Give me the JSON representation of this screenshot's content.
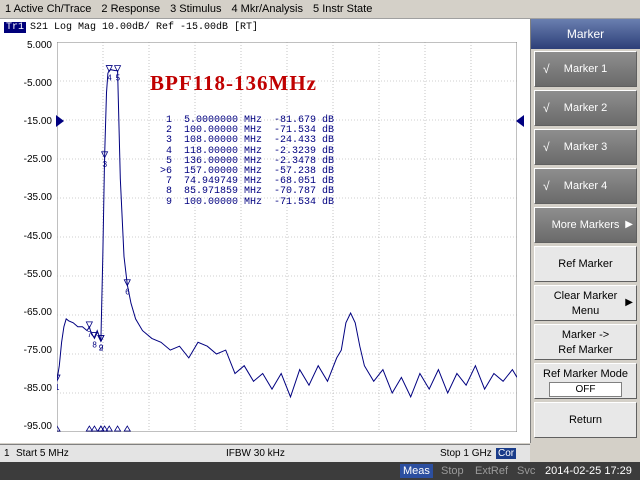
{
  "menu": [
    "1 Active Ch/Trace",
    "2 Response",
    "3 Stimulus",
    "4 Mkr/Analysis",
    "5 Instr State"
  ],
  "trace_header": {
    "badge": "Tr1",
    "text": "S21 Log Mag 10.00dB/ Ref -15.00dB [RT]"
  },
  "title": "BPF118-136MHz",
  "y_axis_labels": [
    "5.000",
    "-5.000",
    "-15.00",
    "-25.00",
    "-35.00",
    "-45.00",
    "-55.00",
    "-65.00",
    "-75.00",
    "-85.00",
    "-95.00"
  ],
  "marker_table": [
    {
      "num": "1",
      "freq": "5.0000000 MHz",
      "val": "-81.679 dB"
    },
    {
      "num": "2",
      "freq": "100.00000 MHz",
      "val": "-71.534 dB"
    },
    {
      "num": "3",
      "freq": "108.00000 MHz",
      "val": "-24.433 dB"
    },
    {
      "num": "4",
      "freq": "118.00000 MHz",
      "val": "-2.3239 dB"
    },
    {
      "num": "5",
      "freq": "136.00000 MHz",
      "val": "-2.3478 dB"
    },
    {
      "num": ">6",
      "freq": "157.00000 MHz",
      "val": "-57.238 dB"
    },
    {
      "num": "7",
      "freq": "74.949749 MHz",
      "val": "-68.051 dB"
    },
    {
      "num": "8",
      "freq": "85.971859 MHz",
      "val": "-70.787 dB"
    },
    {
      "num": "9",
      "freq": "100.00000 MHz",
      "val": "-71.534 dB"
    }
  ],
  "bottom": {
    "channel": "1",
    "start": "Start 5 MHz",
    "ifbw": "IFBW 30 kHz",
    "stop": "Stop 1 GHz",
    "cor": "Cor"
  },
  "softkeys": {
    "header": "Marker",
    "check": "√",
    "marker1": "Marker 1",
    "marker2": "Marker 2",
    "marker3": "Marker 3",
    "marker4": "Marker 4",
    "more_markers": "More Markers",
    "ref_marker": "Ref Marker",
    "clear_marker_1": "Clear Marker",
    "clear_marker_2": "Menu",
    "marker_to_ref_1": "Marker ->",
    "marker_to_ref_2": "Ref Marker",
    "ref_marker_mode": "Ref Marker Mode",
    "ref_marker_mode_value": "OFF",
    "return": "Return"
  },
  "status": {
    "meas": "Meas",
    "stop": "Stop",
    "extref": "ExtRef",
    "svc": "Svc",
    "datetime": "2014-02-25 17:29"
  },
  "colors": {
    "trace": "#000080",
    "title": "#c00000",
    "softkey_header": "#2d3f78"
  },
  "chart_data": {
    "type": "line",
    "x_unit": "MHz",
    "xlim": [
      5,
      1000
    ],
    "ylim": [
      -95,
      5
    ],
    "grid": true,
    "series": [
      {
        "x": [
          5,
          10,
          15,
          20,
          25,
          30,
          40,
          50,
          60,
          70,
          74.95,
          80,
          85.97,
          92,
          100,
          104,
          108,
          112,
          115,
          118,
          122,
          126,
          130,
          136,
          142,
          150,
          157,
          165,
          175,
          190,
          210,
          230,
          250,
          270,
          290,
          310,
          330,
          350,
          370,
          390,
          410,
          430,
          450,
          470,
          490,
          510,
          530,
          550,
          570,
          590,
          610,
          620,
          630,
          640,
          650,
          660,
          670,
          690,
          710,
          730,
          750,
          770,
          790,
          810,
          830,
          850,
          870,
          890,
          910,
          930,
          950,
          970,
          990,
          1000
        ],
        "y": [
          -81.7,
          -78,
          -72,
          -68,
          -66,
          -66.5,
          -67,
          -68,
          -68,
          -69,
          -68.05,
          -70,
          -70.79,
          -69,
          -71.53,
          -50,
          -24.43,
          -8,
          -3,
          -2.32,
          -2.1,
          -2.2,
          -2.3,
          -2.35,
          -30,
          -50,
          -57.24,
          -62,
          -66,
          -69,
          -71,
          -72,
          -74,
          -73,
          -76,
          -72,
          -73,
          -75,
          -74,
          -80,
          -78,
          -82,
          -80,
          -84,
          -80,
          -86,
          -79,
          -83,
          -78,
          -82,
          -76,
          -74,
          -67,
          -64.5,
          -67,
          -73,
          -78,
          -82,
          -79,
          -85,
          -81,
          -86,
          -80,
          -84,
          -79,
          -85,
          -80,
          -83,
          -78,
          -84,
          -80,
          -82,
          -79,
          -81
        ]
      }
    ]
  }
}
